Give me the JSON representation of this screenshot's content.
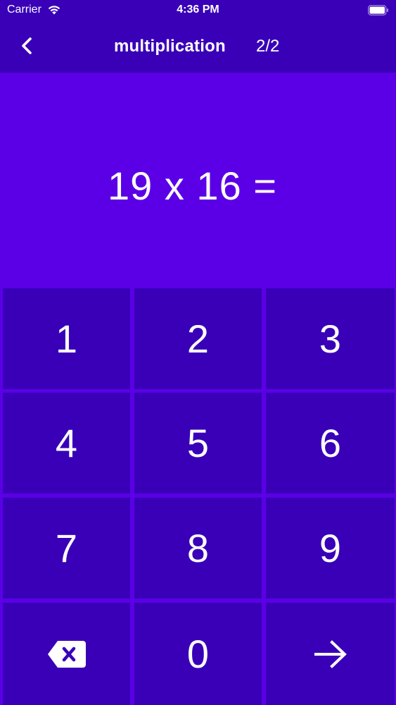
{
  "status_bar": {
    "carrier": "Carrier",
    "time": "4:36 PM"
  },
  "nav": {
    "title": "multiplication",
    "progress": "2/2",
    "back_icon": "chevron-left-icon"
  },
  "question": {
    "expression": "19 x 16 ="
  },
  "keypad": {
    "keys": [
      {
        "label": "1"
      },
      {
        "label": "2"
      },
      {
        "label": "3"
      },
      {
        "label": "4"
      },
      {
        "label": "5"
      },
      {
        "label": "6"
      },
      {
        "label": "7"
      },
      {
        "label": "8"
      },
      {
        "label": "9"
      },
      {
        "icon": "backspace-icon"
      },
      {
        "label": "0"
      },
      {
        "icon": "arrow-right-icon"
      }
    ]
  },
  "colors": {
    "bar_background": "#3900b8",
    "main_background": "#5b00e6",
    "key_background": "#3900b8",
    "text": "#ffffff"
  }
}
